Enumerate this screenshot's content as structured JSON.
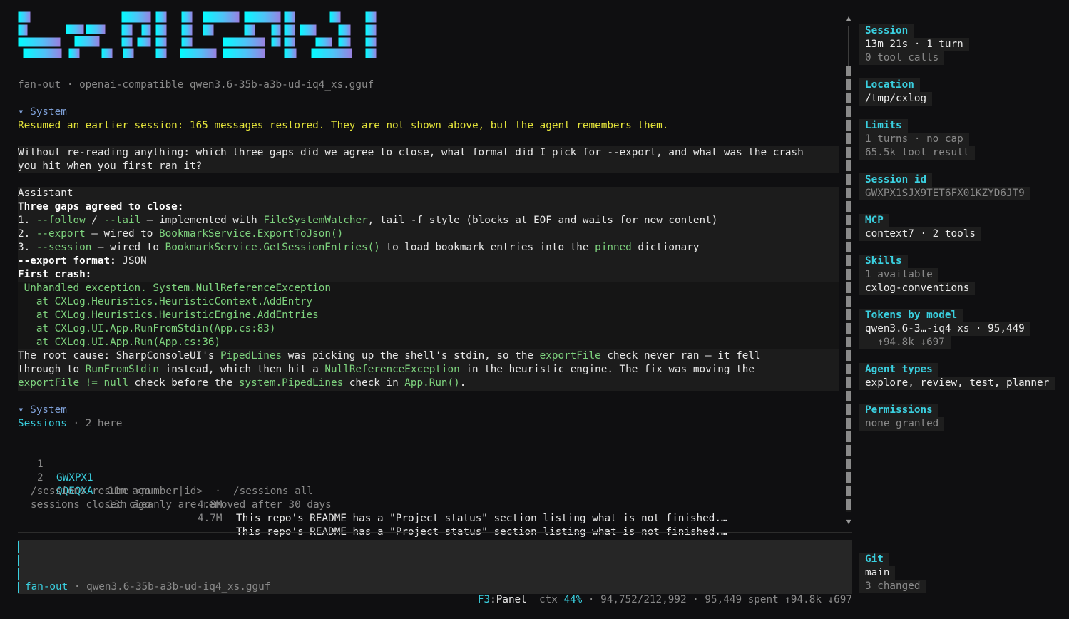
{
  "banner": {
    "gradient": [
      "#00ffff",
      "#4fc3f7",
      "#9b7fe0"
    ]
  },
  "header": {
    "subtitle": "fan-out · openai-compatible qwen3.6-35b-a3b-ud-iq4_xs.gguf"
  },
  "transcript": {
    "system1": {
      "label": "▾ System",
      "message": "Resumed an earlier session: 165 messages restored. They are not shown above, but the agent remembers them."
    },
    "user": {
      "line1": "Without re-reading anything: which three gaps did we agree to close, what format did I pick for --export, and what was the crash",
      "line2": "you hit when you first ran it?"
    },
    "assistant": {
      "label": "Assistant",
      "gaps_heading": "Three gaps agreed to close:",
      "item1": {
        "num": "1. ",
        "flag1": "--follow",
        "sep": " / ",
        "flag2": "--tail",
        "text1": " — implemented with ",
        "code1": "FileSystemWatcher",
        "text2": ", tail -f style (blocks at EOF and waits for new content)"
      },
      "item2": {
        "num": "2. ",
        "flag1": "--export",
        "text1": " — wired to ",
        "code1": "BookmarkService.ExportToJson()"
      },
      "item3": {
        "num": "3. ",
        "flag1": "--session",
        "text1": " — wired to ",
        "code1": "BookmarkService.GetSessionEntries()",
        "text2": " to load bookmark entries into the ",
        "code2": "pinned",
        "text3": " dictionary"
      },
      "export_label": "--export format:",
      "export_value": " JSON",
      "crash_heading": "First crash:",
      "stack": [
        " Unhandled exception. System.NullReferenceException",
        "   at CXLog.Heuristics.HeuristicContext.AddEntry",
        "   at CXLog.Heuristics.HeuristicEngine.AddEntries",
        "   at CXLog.UI.App.RunFromStdin(App.cs:83)",
        "   at CXLog.UI.App.Run(App.cs:36)"
      ],
      "root": {
        "t1": "The root cause: SharpConsoleUI's ",
        "c1": "PipedLines",
        "t2": " was picking up the shell's stdin, so the ",
        "c2": "exportFile",
        "t3": " check never ran — it fell",
        "t4": "through to ",
        "c3": "RunFromStdin",
        "t5": " instead, which then hit a ",
        "c4": "NullReferenceException",
        "t6": " in the heuristic engine. The fix was moving the",
        "c5": "exportFile != null",
        "t7": " check before the ",
        "c6": "system.PipedLines",
        "t8": " check in ",
        "c7": "App.Run()",
        "t9": "."
      }
    },
    "system2": {
      "label": "▾ System",
      "sessions_label": "Sessions",
      "sessions_count": " · 2 here",
      "rows": [
        {
          "num": "1",
          "id": "GWXPX1",
          "age": "11m ago",
          "size": "4.8M",
          "summary": "This repo's README has a \"Project status\" section listing what is not finished.…"
        },
        {
          "num": "2",
          "id": "QQEQXA",
          "age": "13m ago",
          "size": "4.7M",
          "summary": "This repo's README has a \"Project status\" section listing what is not finished.…"
        }
      ],
      "hint1": "/sessions resume <number|id>  ·  /sessions all",
      "hint2": "sessions closed cleanly are removed after 30 days"
    }
  },
  "scrollbar": {
    "up": "▲",
    "down": "▼"
  },
  "input": {
    "agent": "fan-out",
    "model": " · qwen3.6-35b-a3b-ud-iq4_xs.gguf"
  },
  "statusbar": {
    "key": "F3",
    "key_label": ":Panel  ",
    "ctx_label": "ctx ",
    "ctx_pct": "44%",
    "rest": " · 94,752/212,992 · 95,449 spent ↑94.8k ↓697"
  },
  "panel": {
    "session": {
      "title": "Session",
      "line1": "13m 21s · 1 turn",
      "line2": "0 tool calls"
    },
    "location": {
      "title": "Location",
      "value": "/tmp/cxlog"
    },
    "limits": {
      "title": "Limits",
      "line1": "1 turns · no cap",
      "line2": "65.5k tool result"
    },
    "session_id": {
      "title": "Session id",
      "value": "GWXPX1SJX9TET6FX01KZYD6JT9"
    },
    "mcp": {
      "title": "MCP",
      "value": "context7 · 2 tools"
    },
    "skills": {
      "title": "Skills",
      "line1": "1 available",
      "line2": "cxlog-conventions"
    },
    "tokens": {
      "title": "Tokens by model",
      "line1": "qwen3.6-3…-iq4_xs · 95,449",
      "line2": "  ↑94.8k ↓697"
    },
    "agent_types": {
      "title": "Agent types",
      "value": "explore, review, test, planner"
    },
    "permissions": {
      "title": "Permissions",
      "value": "none granted"
    },
    "git": {
      "title": "Git",
      "line1": "main",
      "line2": "3 changed"
    }
  }
}
